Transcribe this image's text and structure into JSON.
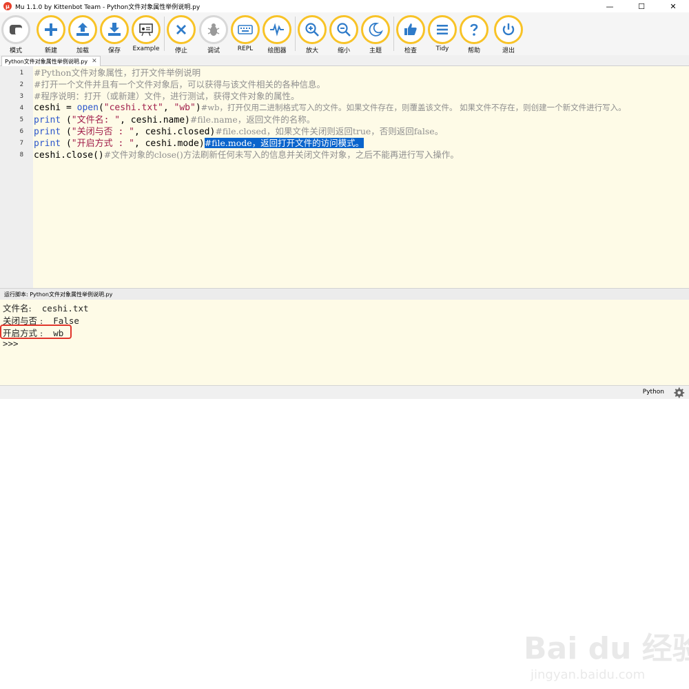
{
  "window": {
    "title": "Mu 1.1.0 by Kittenbot Team - Python文件对象属性举例说明.py",
    "app_icon_glyph": "μ",
    "minimize": "—",
    "maximize": "☐",
    "close": "✕"
  },
  "toolbar": {
    "mode": "模式",
    "new": "新建",
    "load": "加载",
    "save": "保存",
    "example": "Example",
    "stop": "停止",
    "debug": "调试",
    "repl": "REPL",
    "plotter": "绘图器",
    "zoom_in": "放大",
    "zoom_out": "缩小",
    "theme": "主题",
    "check": "检查",
    "tidy": "Tidy",
    "help": "帮助",
    "quit": "退出"
  },
  "tab": {
    "filename": "Python文件对象属性举例说明.py",
    "close": "✕"
  },
  "editor": {
    "line_numbers": [
      "1",
      "2",
      "3",
      "4",
      "5",
      "6",
      "7",
      "8"
    ],
    "line1": "#Python文件对象属性，打开文件举例说明",
    "line2": "#打开一个文件并且有一个文件对象后，可以获得与该文件相关的各种信息。",
    "line3": "#程序说明：打开（或新建）文件，进行测试，获得文件对象的属性。",
    "line4_a": "ceshi = ",
    "line4_b": "open",
    "line4_c": "(",
    "line4_d": "\"ceshi.txt\"",
    "line4_e": ", ",
    "line4_f": "\"wb\"",
    "line4_g": ")",
    "line4_h": "#wb，打开仅用二进制格式写入的文件。如果文件存在，则覆盖该文件。 如果文件不存在，则创建一个新文件进行写入。",
    "line5_a": "print",
    "line5_b": " (",
    "line5_c": "\"文件名: \"",
    "line5_d": ", ceshi.name)",
    "line5_e": "#file.name，返回文件的名称。",
    "line6_a": "print",
    "line6_b": " (",
    "line6_c": "\"关闭与否 : \"",
    "line6_d": ", ceshi.closed)",
    "line6_e": "#file.closed，如果文件关闭则返回true，否则返回false。",
    "line7_a": "print",
    "line7_b": " (",
    "line7_c": "\"开启方式 : \"",
    "line7_d": ", ceshi.mode)",
    "line7_e": "#file.mode，返回打开文件的访问模式。",
    "line8_a": "ceshi.close()",
    "line8_b": "#文件对象的close()方法刷新任何未写入的信息并关闭文件对象，之后不能再进行写入操作。"
  },
  "repl": {
    "header": "运行脚本: Python文件对象属性举例说明.py",
    "out1_label": "文件名:",
    "out1_value": "  ceshi.txt",
    "out2_label": "关闭与否 :",
    "out2_value": "  False",
    "out3_label": "开启方式 :",
    "out3_value": "  wb",
    "prompt": ">>>"
  },
  "watermark": {
    "logo": "Bai du 经验",
    "url": "jingyan.baidu.com"
  },
  "status": {
    "mode": "Python"
  },
  "colors": {
    "toolbar_ring": "#f8c327",
    "selection": "#0a64cc",
    "keyword": "#2a55cc",
    "string": "#a11e4a",
    "comment": "#8f8f8f",
    "highlight_box": "#e0342a"
  }
}
